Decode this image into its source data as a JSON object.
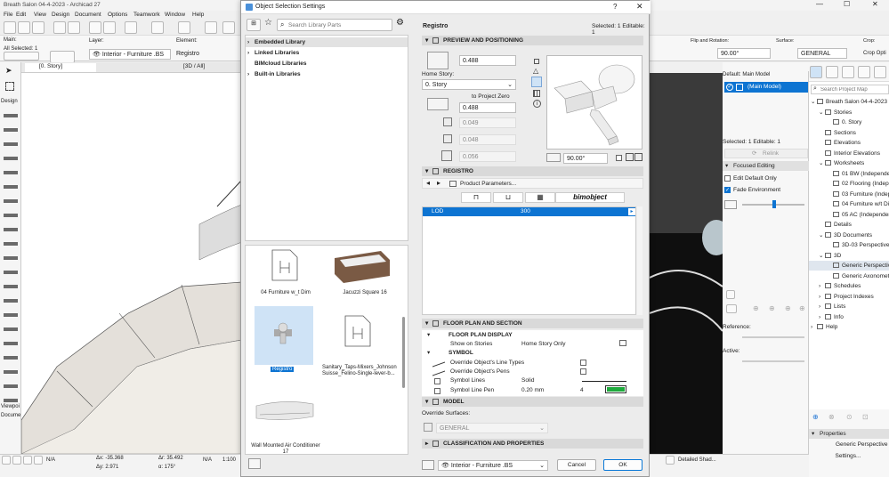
{
  "window_title": "Breath Salon 04-4-2023 - Archicad 27",
  "menu": [
    "File",
    "Edit",
    "View",
    "Design",
    "Document",
    "Options",
    "Teamwork",
    "Window",
    "Help"
  ],
  "info_box": {
    "main_label": "Main:",
    "selected_label": "All Selected: 1",
    "layer_label": "Layer:",
    "layer_value": "Interior - Furniture .BS",
    "element_label": "Element:",
    "element_value": "Registro",
    "flip_label": "Flip and Rotation:",
    "rotation_value": "90.00°",
    "surface_label": "Surface:",
    "surface_value": "GENERAL",
    "crop_label": "Crop:",
    "crop_value": "Crop Opti"
  },
  "view_tabs": [
    "[0. Story]",
    "[3D / All]"
  ],
  "toolbox": {
    "label": "Design",
    "viewpoint_label": "Viewpoi",
    "document_label": "Docume"
  },
  "dialog": {
    "title": "Object Selection Settings",
    "search_placeholder": "Search Library Parts",
    "libraries": [
      "Embedded Library",
      "Linked Libraries",
      "BIMcloud Libraries",
      "Built-in Libraries"
    ],
    "parts": [
      {
        "name": "04 Furniture w_t Dim",
        "selected": false
      },
      {
        "name": "Jacuzzi Square 16",
        "selected": false
      },
      {
        "name": "Registro",
        "selected": true
      },
      {
        "name": "Sanitary_Taps-Mixers_Johnson Suisse_Felino-Single-lever-b...",
        "selected": false
      },
      {
        "name": "Wall Mounted Air Conditioner 17",
        "selected": false
      }
    ],
    "object_name": "Registro",
    "selected_status": "Selected: 1 Editable: 1",
    "preview": {
      "section": "PREVIEW AND POSITIONING",
      "height_value": "0.488",
      "home_story_label": "Home Story:",
      "home_story_value": "0. Story",
      "to_project_zero": "to Project Zero",
      "elevation_value": "0.488",
      "dim_a": "0.049",
      "dim_b": "0.048",
      "dim_c": "0.056",
      "angle_value": "90.00°"
    },
    "registro": {
      "section": "REGISTRO",
      "product_params": "Product Parameters...",
      "bim_logo": "bimobject",
      "param_name": "LOD",
      "param_value": "300"
    },
    "floor_plan": {
      "section": "FLOOR PLAN AND SECTION",
      "display_header": "FLOOR PLAN DISPLAY",
      "show_on_stories_label": "Show on Stories",
      "show_on_stories_value": "Home Story Only",
      "symbol_header": "SYMBOL",
      "override_line_types": "Override Object's Line Types",
      "override_pens": "Override Object's Pens",
      "symbol_lines_label": "Symbol Lines",
      "symbol_lines_value": "Solid",
      "symbol_pen_label": "Symbol Line Pen",
      "symbol_pen_value": "0.20 mm",
      "symbol_pen_number": "4"
    },
    "model": {
      "section": "MODEL",
      "override_surfaces_label": "Override Surfaces:",
      "surface_value": "GENERAL"
    },
    "classification": {
      "section": "CLASSIFICATION AND PROPERTIES"
    },
    "footer": {
      "layer_value": "Interior - Furniture .BS",
      "cancel_label": "Cancel",
      "ok_label": "OK"
    }
  },
  "navigator": {
    "default_label": "Default: Main Model",
    "main_model": "(Main Model)",
    "selected_status": "Selected: 1 Editable: 1",
    "relink": "Relink",
    "focused_editing": "Focused Editing",
    "edit_default_only": "Edit Default Only",
    "fade_environment": "Fade Environment",
    "reference_label": "Reference:",
    "active_label": "Active:",
    "search_placeholder": "Search Project Map",
    "tree": [
      {
        "label": "Breath Salon 04-4-2023",
        "level": 0,
        "expander": "v"
      },
      {
        "label": "Stories",
        "level": 1,
        "expander": "v"
      },
      {
        "label": "0. Story",
        "level": 2,
        "expander": ""
      },
      {
        "label": "Sections",
        "level": 1,
        "expander": ""
      },
      {
        "label": "Elevations",
        "level": 1,
        "expander": ""
      },
      {
        "label": "Interior Elevations",
        "level": 1,
        "expander": ""
      },
      {
        "label": "Worksheets",
        "level": 1,
        "expander": "v"
      },
      {
        "label": "01 BW (Independent)",
        "level": 2,
        "expander": ""
      },
      {
        "label": "02 Flooring (Independ",
        "level": 2,
        "expander": ""
      },
      {
        "label": "03 Furniture (Independ",
        "level": 2,
        "expander": ""
      },
      {
        "label": "04 Furniture w/t Dim (I",
        "level": 2,
        "expander": ""
      },
      {
        "label": "05 AC (Independent)",
        "level": 2,
        "expander": ""
      },
      {
        "label": "Details",
        "level": 1,
        "expander": ""
      },
      {
        "label": "3D Documents",
        "level": 1,
        "expander": "v"
      },
      {
        "label": "3D-03 Perspective (Aut",
        "level": 2,
        "expander": ""
      },
      {
        "label": "3D",
        "level": 1,
        "expander": "v"
      },
      {
        "label": "Generic Perspective",
        "level": 2,
        "expander": "",
        "selected": true
      },
      {
        "label": "Generic Axonometry",
        "level": 2,
        "expander": ""
      },
      {
        "label": "Schedules",
        "level": 1,
        "expander": ">"
      },
      {
        "label": "Project Indexes",
        "level": 1,
        "expander": ">"
      },
      {
        "label": "Lists",
        "level": 1,
        "expander": ">"
      },
      {
        "label": "Info",
        "level": 1,
        "expander": ">"
      },
      {
        "label": "Help",
        "level": 0,
        "expander": ">"
      }
    ],
    "properties_label": "Properties",
    "properties_value": "Generic Perspective",
    "settings_label": "Settings..."
  },
  "status_bar": {
    "na_1": "N/A",
    "dx": "Δx: -35.368",
    "dy": "Δy: 2.971",
    "dr": "Δr: 35.492",
    "da": "α: 175°",
    "na_2": "N/A",
    "scale": "1:100",
    "detailed": "Detailed Shad..."
  },
  "colors": {
    "accent": "#0a78d7",
    "selection": "#0d74d2",
    "header_bg": "#d9d9d9"
  }
}
